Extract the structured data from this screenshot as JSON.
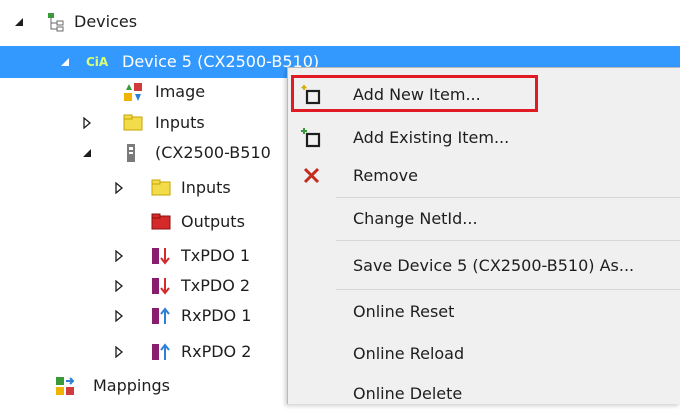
{
  "tree": {
    "root_label": "Devices",
    "device_label": "Device 5 (CX2500-B510)",
    "device_tag": "CiA",
    "children": [
      {
        "label": "Image"
      },
      {
        "label": "Inputs"
      },
      {
        "label": "(CX2500-B510"
      },
      {
        "label": "Inputs"
      },
      {
        "label": "Outputs"
      },
      {
        "label": "TxPDO 1"
      },
      {
        "label": "TxPDO 2"
      },
      {
        "label": "RxPDO 1"
      },
      {
        "label": "RxPDO 2"
      }
    ],
    "mappings_label": "Mappings"
  },
  "context_menu": {
    "items": [
      {
        "label": "Add New Item...",
        "icon": "add-new-item-icon"
      },
      {
        "label": "Add Existing Item...",
        "icon": "add-existing-item-icon"
      },
      {
        "label": "Remove",
        "icon": "remove-x-icon"
      },
      {
        "label": "Change NetId..."
      },
      {
        "label": "Save Device 5 (CX2500-B510) As..."
      },
      {
        "label": "Online Reset"
      },
      {
        "label": "Online Reload"
      },
      {
        "label": "Online Delete"
      }
    ]
  },
  "colors": {
    "selection": "#3399ff",
    "highlight_box": "#e01b24",
    "remove_icon": "#c42b1c"
  }
}
